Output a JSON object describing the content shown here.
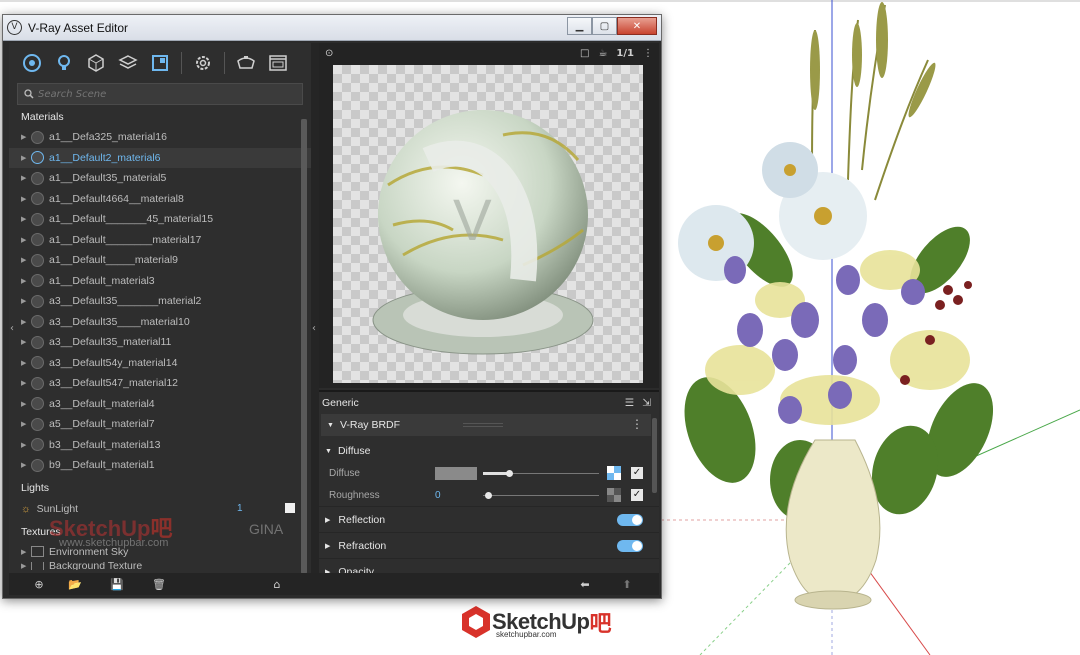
{
  "window": {
    "title": "V-Ray Asset Editor"
  },
  "toolbar": {
    "icons": [
      "materials-icon",
      "lights-icon",
      "geometry-icon",
      "textures-icon",
      "render-elements-icon",
      "settings-icon",
      "render-icon",
      "frame-buffer-icon"
    ]
  },
  "search": {
    "placeholder": "Search Scene"
  },
  "materials": {
    "heading": "Materials",
    "items": [
      "a1__Defa325_material16",
      "a1__Default2_material6",
      "a1__Default35_material5",
      "a1__Default4664__material8",
      "a1__Default_______45_material15",
      "a1__Default________material17",
      "a1__Default_____material9",
      "a1__Default_material3",
      "a3__Default35_______material2",
      "a3__Default35____material10",
      "a3__Default35_material11",
      "a3__Default54y_material14",
      "a3__Default547_material12",
      "a3__Default_material4",
      "a5__Default_material7",
      "b3__Default_material13",
      "b9__Default_material1"
    ],
    "selected_index": 1
  },
  "lights": {
    "heading": "Lights",
    "items": [
      {
        "label": "SunLight",
        "count": "1"
      }
    ]
  },
  "textures": {
    "heading": "Textures",
    "items": [
      "Environment Sky",
      "Background Texture"
    ]
  },
  "properties": {
    "heading": "Generic",
    "brdf": "V-Ray BRDF",
    "diffuse_group": "Diffuse",
    "diffuse_label": "Diffuse",
    "roughness_label": "Roughness",
    "roughness_value": "0",
    "reflection": "Reflection",
    "refraction": "Refraction",
    "opacity": "Opacity"
  },
  "preview": {
    "ratio": "1/1"
  },
  "watermark": {
    "brand": "SketchUp",
    "brand_suffix": "吧",
    "site": "sketchupbar.com",
    "site_inline": "www.sketchupbar.com",
    "gina": "GINA"
  },
  "colors": {
    "accent": "#6fb8ef",
    "panel": "#2e2e2e",
    "dark": "#232323"
  }
}
